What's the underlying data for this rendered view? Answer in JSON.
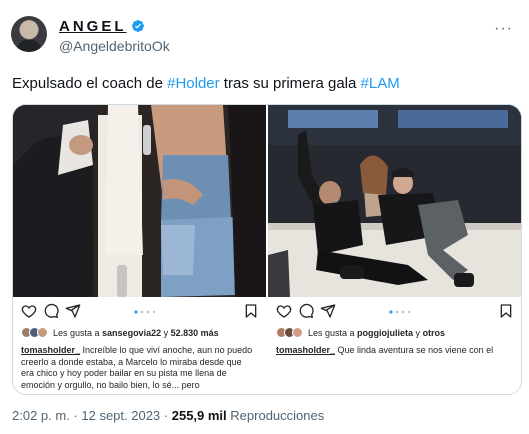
{
  "author": {
    "display_name": "ANGEL",
    "handle": "@AngeldebritoOk",
    "verified": true
  },
  "icons": {
    "avatar": "profile-photo",
    "verified": "verified-badge-icon",
    "more": "more-dots-icon",
    "ig": [
      "heart-icon",
      "comment-icon",
      "share-icon",
      "bookmark-icon"
    ]
  },
  "tweet": {
    "text_before": "Expulsado el coach de ",
    "hashtag1": "#Holder",
    "text_middle": " tras su primera gala ",
    "hashtag2": "#LAM"
  },
  "media": {
    "left": {
      "likes_prefix": "Les gusta a ",
      "likes_user": "sansegovia22",
      "likes_mid": " y ",
      "likes_count": "52.830 más",
      "caption_user": "tomasholder_",
      "caption_text": " Increíble lo que viví anoche, aun no puedo creerlo a donde estaba, a Marcelo lo miraba desde que era chico y hoy poder bailar en su pista me llena de emoción y orgullo, no bailo bien, lo sé... pero"
    },
    "right": {
      "likes_prefix": "Les gusta a ",
      "likes_user": "poggiojulieta",
      "likes_mid": " y ",
      "likes_count": "otros",
      "caption_user": "tomasholder_",
      "caption_text": " Que linda aventura se nos viene con el"
    }
  },
  "footer": {
    "time": "2:02 p. m.",
    "sep": " · ",
    "date": "12 sept. 2023",
    "sep2": " · ",
    "views": "255,9 mil",
    "views_label": " Reproducciones"
  },
  "colors": {
    "link": "#1d9bf0",
    "verified": "#1d9bf0",
    "ig_dot_active": "#3897f0"
  }
}
